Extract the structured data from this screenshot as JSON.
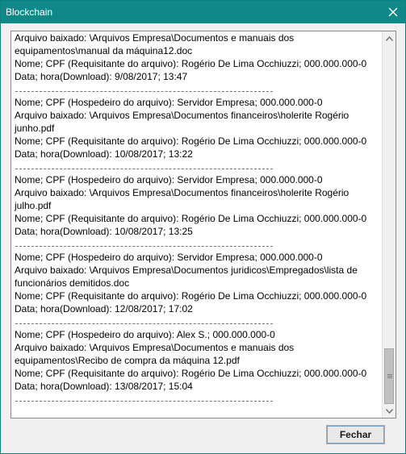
{
  "window": {
    "title": "Blockchain",
    "close_icon": "close-icon"
  },
  "log": {
    "lines": [
      {
        "type": "text",
        "text": "Arquivo baixado: \\Arquivos Empresa\\Documentos e manuais dos"
      },
      {
        "type": "text",
        "text": "equipamentos\\manual da máquina12.doc"
      },
      {
        "type": "text",
        "text": "Nome; CPF (Requisitante do arquivo): Rogério De Lima Occhiuzzi; 000.000.000-0"
      },
      {
        "type": "text",
        "text": "Data; hora(Download): 9/08/2017; 13:47"
      },
      {
        "type": "sep",
        "text": ""
      },
      {
        "type": "text",
        "text": "Nome; CPF (Hospedeiro do arquivo): Servidor Empresa; 000.000.000-0"
      },
      {
        "type": "text",
        "text": "Arquivo baixado: \\Arquivos Empresa\\Documentos financeiros\\holerite Rogério"
      },
      {
        "type": "text",
        "text": "junho.pdf"
      },
      {
        "type": "text",
        "text": "Nome; CPF (Requisitante do arquivo): Rogério De Lima Occhiuzzi; 000.000.000-0"
      },
      {
        "type": "text",
        "text": "Data; hora(Download): 10/08/2017; 13:22"
      },
      {
        "type": "sep",
        "text": ""
      },
      {
        "type": "text",
        "text": "Nome; CPF (Hospedeiro do arquivo): Servidor Empresa; 000.000.000-0"
      },
      {
        "type": "text",
        "text": "Arquivo baixado: \\Arquivos Empresa\\Documentos financeiros\\holerite Rogério"
      },
      {
        "type": "text",
        "text": "julho.pdf"
      },
      {
        "type": "text",
        "text": "Nome; CPF (Requisitante do arquivo): Rogério De Lima Occhiuzzi; 000.000.000-0"
      },
      {
        "type": "text",
        "text": "Data; hora(Download): 10/08/2017; 13:25"
      },
      {
        "type": "sep",
        "text": ""
      },
      {
        "type": "text",
        "text": "Nome; CPF (Hospedeiro do arquivo): Servidor Empresa; 000.000.000-0"
      },
      {
        "type": "text",
        "text": "Arquivo baixado: \\Arquivos Empresa\\Documentos juridicos\\Empregados\\lista de"
      },
      {
        "type": "text",
        "text": "funcionários demitidos.doc"
      },
      {
        "type": "text",
        "text": "Nome; CPF (Requisitante do arquivo): Rogério De Lima Occhiuzzi; 000.000.000-0"
      },
      {
        "type": "text",
        "text": "Data; hora(Download): 12/08/2017; 17:02"
      },
      {
        "type": "sep",
        "text": ""
      },
      {
        "type": "text",
        "text": "Nome; CPF (Hospedeiro do arquivo): Alex S.; 000.000.000-0"
      },
      {
        "type": "text",
        "text": "Arquivo baixado: \\Arquivos Empresa\\Documentos e manuais dos"
      },
      {
        "type": "text",
        "text": "equipamentos\\Recibo de compra da máquina 12.pdf"
      },
      {
        "type": "text",
        "text": "Nome; CPF (Requisitante do arquivo): Rogério De Lima Occhiuzzi; 000.000.000-0"
      },
      {
        "type": "text",
        "text": "Data; hora(Download): 13/08/2017; 15:04"
      },
      {
        "type": "sep",
        "text": ""
      }
    ]
  },
  "scrollbar": {
    "position_fraction": 0.86,
    "up_icon": "scroll-up-arrow-icon",
    "down_icon": "scroll-down-arrow-icon"
  },
  "footer": {
    "close_label": "Fechar"
  },
  "colors": {
    "titlebar": "#108888",
    "title_text": "#ffffff",
    "window_bg": "#f0f0f0"
  }
}
